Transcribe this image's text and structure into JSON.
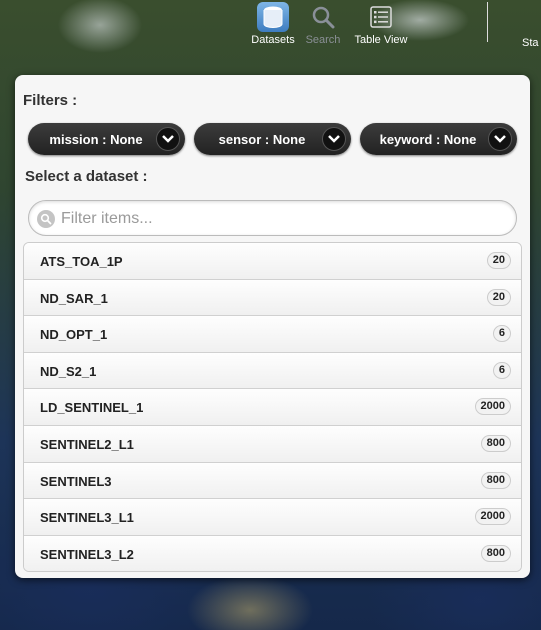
{
  "toolbar": {
    "datasets_label": "Datasets",
    "search_label": "Search",
    "table_view_label": "Table View",
    "status_label": "Sta"
  },
  "panel": {
    "filters_title": "Filters :",
    "filters": [
      {
        "label": "mission : None"
      },
      {
        "label": "sensor : None"
      },
      {
        "label": "keyword : None"
      }
    ],
    "select_title": "Select a dataset :",
    "search_placeholder": "Filter items...",
    "datasets": [
      {
        "name": "ATS_TOA_1P",
        "count": "20"
      },
      {
        "name": "ND_SAR_1",
        "count": "20"
      },
      {
        "name": "ND_OPT_1",
        "count": "6"
      },
      {
        "name": "ND_S2_1",
        "count": "6"
      },
      {
        "name": "LD_SENTINEL_1",
        "count": "2000"
      },
      {
        "name": "SENTINEL2_L1",
        "count": "800"
      },
      {
        "name": "SENTINEL3",
        "count": "800"
      },
      {
        "name": "SENTINEL3_L1",
        "count": "2000"
      },
      {
        "name": "SENTINEL3_L2",
        "count": "800"
      }
    ]
  },
  "icons": {
    "datasets": "database-icon",
    "search": "search-icon",
    "table_view": "table-list-icon",
    "filter_chevron": "chevron-down-icon",
    "filter_search": "search-icon"
  },
  "colors": {
    "active_tab": "#4f8fd0",
    "filter_button": "#2a2a2a",
    "panel_bg": "#f6f6f6"
  }
}
